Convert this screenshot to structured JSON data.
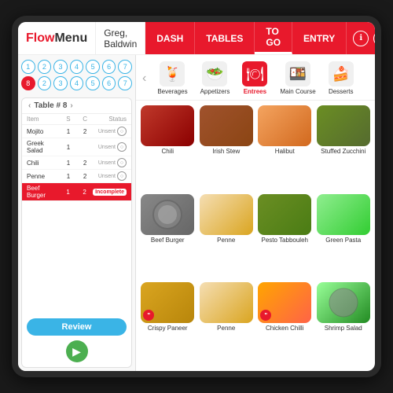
{
  "app": {
    "logo": "FlowMenu",
    "logo_flow": "Flow",
    "logo_menu": "Menu",
    "user": "Greg, Baldwin"
  },
  "nav": {
    "tabs": [
      "DASH",
      "TABLES",
      "TO GO",
      "ENTRY"
    ],
    "active": "ENTRY",
    "icons": [
      "info-icon",
      "refresh-icon"
    ]
  },
  "table_numbers": {
    "row1": [
      1,
      2,
      3,
      4,
      5,
      6,
      7
    ],
    "row2": [
      8,
      2,
      3,
      4,
      5,
      6,
      7
    ]
  },
  "order": {
    "table_label": "Table # 8",
    "columns": [
      "Item",
      "S",
      "C",
      "Status"
    ],
    "items": [
      {
        "name": "Mojito",
        "s": 1,
        "c": 2,
        "status": "Unsent"
      },
      {
        "name": "Greek Salad",
        "s": 1,
        "c": "",
        "status": "Unsent"
      },
      {
        "name": "Chili",
        "s": 1,
        "c": 2,
        "status": "Unsent"
      },
      {
        "name": "Penne",
        "s": 1,
        "c": 2,
        "status": "Unsent"
      },
      {
        "name": "Beef Burger",
        "s": 1,
        "c": 2,
        "status": "Incomplete",
        "highlighted": true
      }
    ],
    "review_btn": "Review"
  },
  "categories": [
    {
      "id": "beverages",
      "label": "Beverages",
      "icon": "beverages"
    },
    {
      "id": "appetizers",
      "label": "Appetizers",
      "icon": "appetizers"
    },
    {
      "id": "entrees",
      "label": "Entrees",
      "icon": "entrees",
      "active": true
    },
    {
      "id": "maincourse",
      "label": "Main Course",
      "icon": "maincourse"
    },
    {
      "id": "desserts",
      "label": "Desserts",
      "icon": "desserts"
    }
  ],
  "foods": [
    {
      "name": "Chili",
      "class": "food-chili",
      "badge": null
    },
    {
      "name": "Irish Stew",
      "class": "food-irish-stew",
      "badge": null
    },
    {
      "name": "Halibut",
      "class": "food-halibut",
      "badge": null
    },
    {
      "name": "Stuffed Zucchini",
      "class": "food-stuffed-zucchini",
      "badge": null
    },
    {
      "name": "Beef Burger",
      "class": "food-beef-burger",
      "badge": null
    },
    {
      "name": "Penne",
      "class": "food-penne",
      "badge": null
    },
    {
      "name": "Pesto Tabbouleh",
      "class": "food-pesto",
      "badge": null
    },
    {
      "name": "Green Pasta",
      "class": "food-green-pasta",
      "badge": null
    },
    {
      "name": "Crispy Paneer",
      "class": "food-crispy",
      "badge": "\""
    },
    {
      "name": "Penne",
      "class": "food-penne2",
      "badge": null
    },
    {
      "name": "Chicken Chilli",
      "class": "food-chicken",
      "badge": "\""
    },
    {
      "name": "Shrimp Salad",
      "class": "food-shrimp",
      "badge": null
    }
  ],
  "colors": {
    "brand_red": "#e8192c",
    "brand_blue": "#3ab4e6",
    "brand_green": "#4caf50"
  }
}
